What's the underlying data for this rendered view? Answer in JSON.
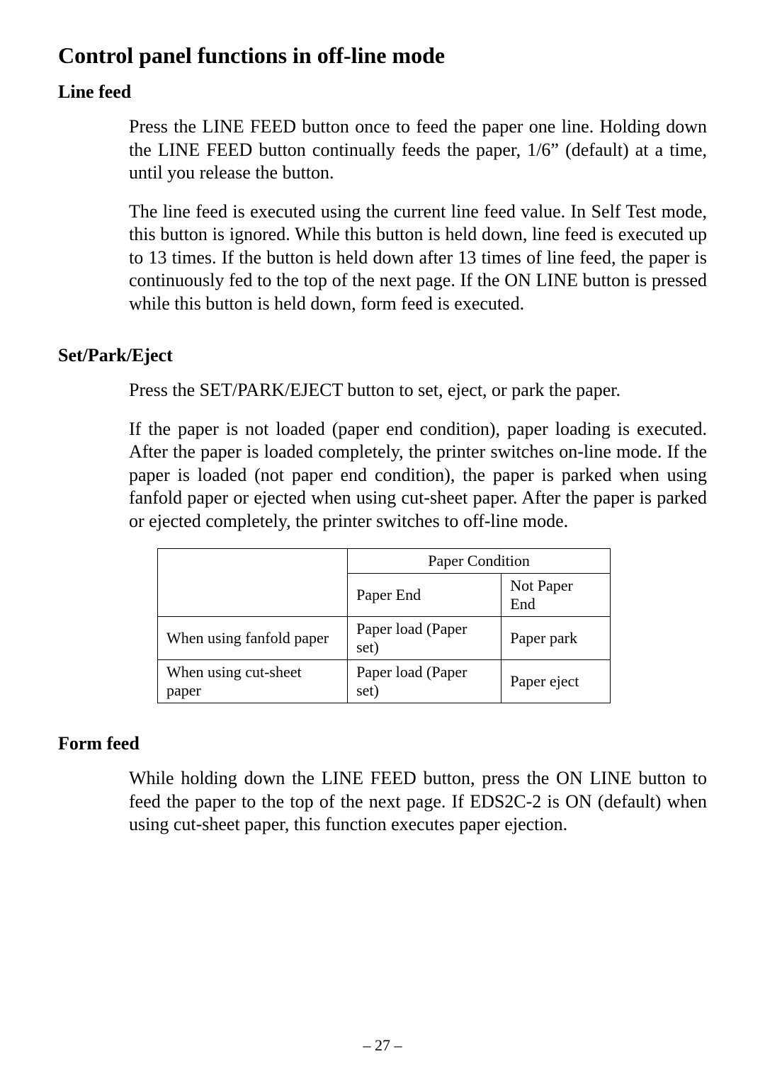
{
  "title": "Control panel functions in off-line mode",
  "sections": {
    "lineFeed": {
      "heading": "Line feed",
      "p1": "Press the LINE FEED button once to feed the paper one line. Holding down the LINE FEED button continually feeds the paper, 1/6” (default) at a time, until you release the button.",
      "p2": "The line feed is executed using the current line feed value. In Self Test mode, this button is ignored. While this button is held down, line feed is executed up to 13 times. If the button is held down after 13 times of line feed, the paper is continuously fed to the top of the next page. If the ON LINE button is pressed while this button is held down, form feed is executed."
    },
    "setParkEject": {
      "heading": "Set/Park/Eject",
      "p1": "Press the SET/PARK/EJECT button to set, eject, or park the paper.",
      "p2": "If the paper is not loaded (paper end condition), paper loading is executed. After the paper is loaded completely, the printer switches on-line mode. If the paper is loaded (not paper end condition), the paper is parked when using fanfold paper or ejected when using cut-sheet paper. After the paper is parked or ejected completely, the printer switches to off-line mode."
    },
    "formFeed": {
      "heading": "Form feed",
      "p1": "While holding down the LINE FEED button, press the ON LINE button to feed the paper to the top of the next page. If EDS2C-2 is ON (default) when using cut-sheet paper, this function executes paper ejection."
    }
  },
  "table": {
    "headerGroup": "Paper Condition",
    "col1": "Paper End",
    "col2": "Not Paper End",
    "rows": [
      {
        "label": "When using fanfold paper",
        "c1": "Paper load (Paper set)",
        "c2": "Paper park"
      },
      {
        "label": "When using cut-sheet paper",
        "c1": "Paper load (Paper set)",
        "c2": "Paper eject"
      }
    ]
  },
  "pageNumber": "– 27 –"
}
